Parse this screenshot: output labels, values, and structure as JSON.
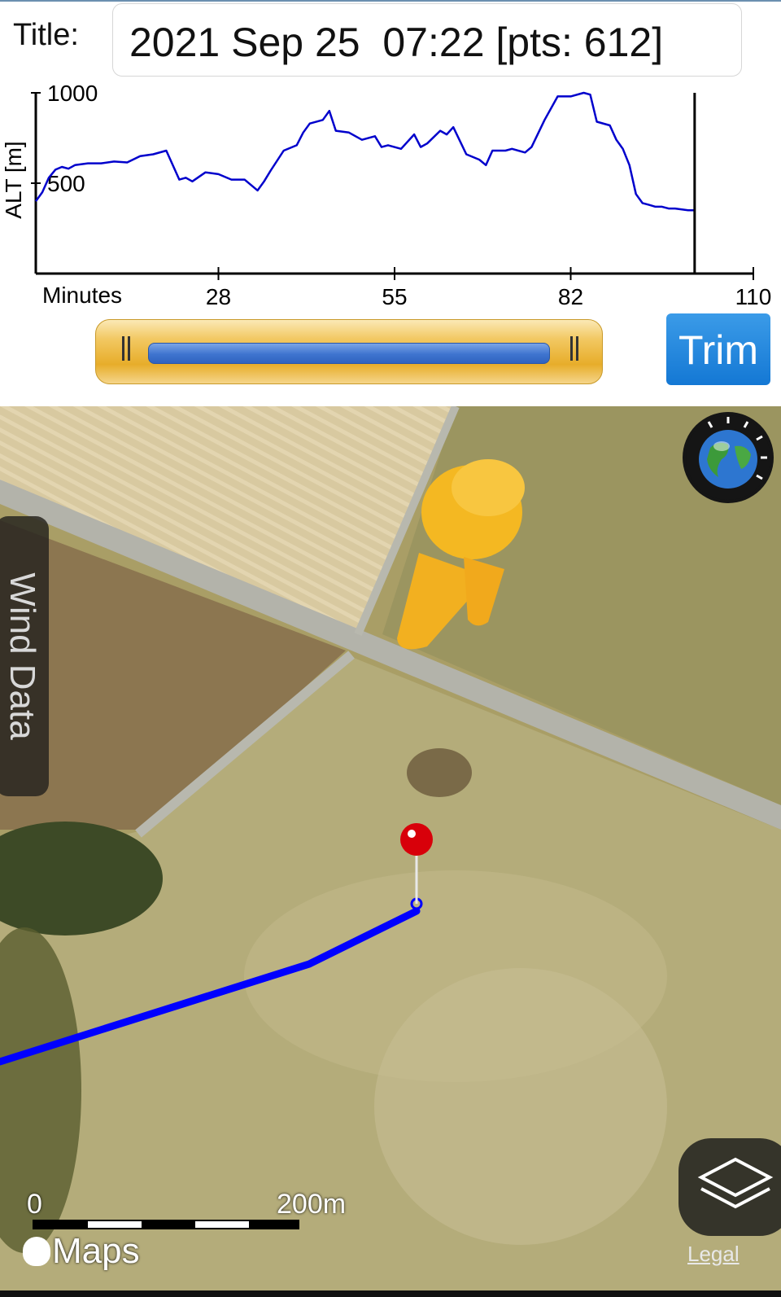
{
  "header": {
    "title_label": "Title:",
    "title_value": "2021 Sep 25  07:22 [pts: 612]"
  },
  "chart_data": {
    "type": "line",
    "ylabel": "ALT [m]",
    "xlabel": "Minutes",
    "yticks": [
      500,
      1000
    ],
    "ytick_labels": [
      "500",
      "1000"
    ],
    "xticks": [
      28,
      55,
      82,
      110
    ],
    "xtick_labels": [
      "28",
      "55",
      "82",
      "110"
    ],
    "xlim": [
      0,
      110
    ],
    "ylim": [
      0,
      1000
    ],
    "cursor_x": 101,
    "line_color": "#0000cc",
    "series": [
      {
        "x": [
          0,
          1,
          2,
          3,
          4,
          5,
          6,
          8,
          10,
          12,
          14,
          16,
          18,
          20,
          22,
          23,
          24,
          26,
          28,
          30,
          32,
          34,
          35,
          36,
          38,
          40,
          41,
          42,
          44,
          45,
          46,
          48,
          50,
          52,
          53,
          54,
          56,
          58,
          59,
          60,
          62,
          63,
          64,
          66,
          68,
          69,
          70,
          72,
          73,
          75,
          76,
          78,
          80,
          82,
          84,
          85,
          86,
          88,
          89,
          90,
          91,
          92,
          93,
          94,
          95,
          96,
          97,
          98,
          100,
          101
        ],
        "y": [
          400,
          450,
          530,
          575,
          590,
          580,
          600,
          610,
          610,
          620,
          615,
          650,
          660,
          680,
          520,
          530,
          510,
          560,
          550,
          520,
          520,
          460,
          510,
          570,
          680,
          710,
          780,
          830,
          850,
          900,
          790,
          780,
          740,
          760,
          700,
          710,
          690,
          770,
          700,
          720,
          790,
          770,
          810,
          660,
          630,
          600,
          680,
          680,
          690,
          670,
          700,
          850,
          980,
          980,
          1000,
          990,
          840,
          820,
          740,
          690,
          600,
          440,
          390,
          380,
          370,
          370,
          360,
          360,
          350,
          350
        ]
      }
    ]
  },
  "trim": {
    "label": "Trim"
  },
  "map": {
    "wind_tab_label": "Wind Data",
    "scale_zero": "0",
    "scale_label": "200m",
    "brand": "Maps",
    "legal": "Legal",
    "track_color": "#0000ff",
    "pin_color": "#d8000a"
  }
}
